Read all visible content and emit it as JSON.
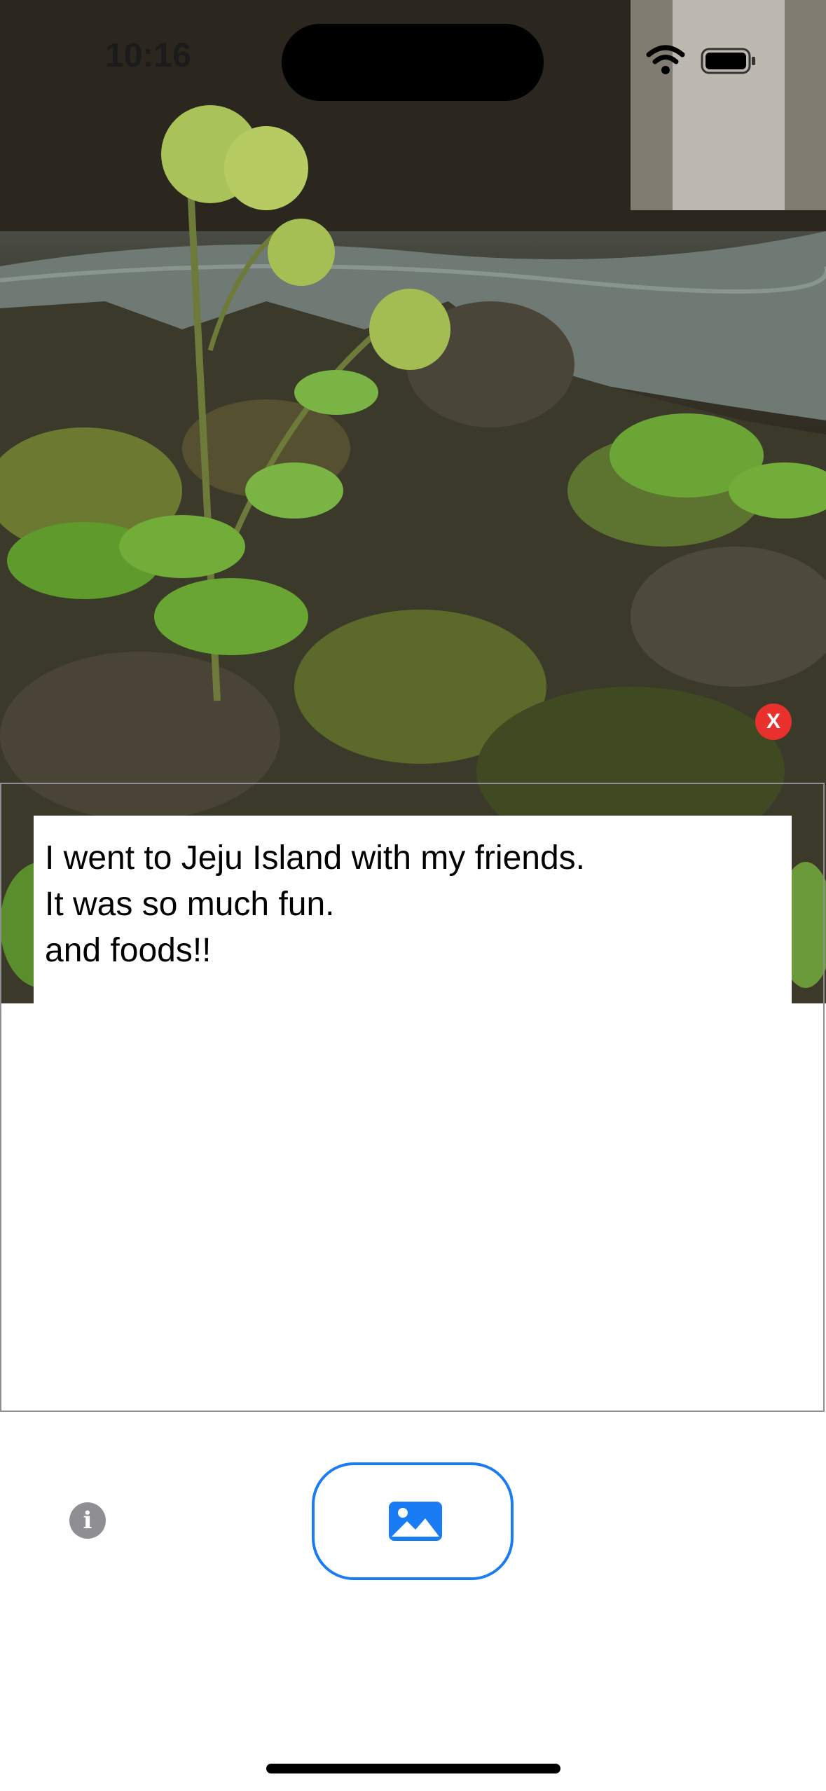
{
  "status_bar": {
    "time": "10:16",
    "icons": [
      "wifi-icon",
      "battery-icon"
    ]
  },
  "photo": {
    "description_icon": "landscape-photo"
  },
  "editor": {
    "close_label": "X",
    "lines": [
      "I went to Jeju Island with my friends.",
      "It was so much fun.",
      "and foods!!"
    ]
  },
  "toolbar": {
    "info_label": "i",
    "photo_icon": "photo-icon"
  },
  "colors": {
    "accent": "#1a7cf5",
    "close_red": "#e8312c",
    "gray": "#8e8e93"
  }
}
